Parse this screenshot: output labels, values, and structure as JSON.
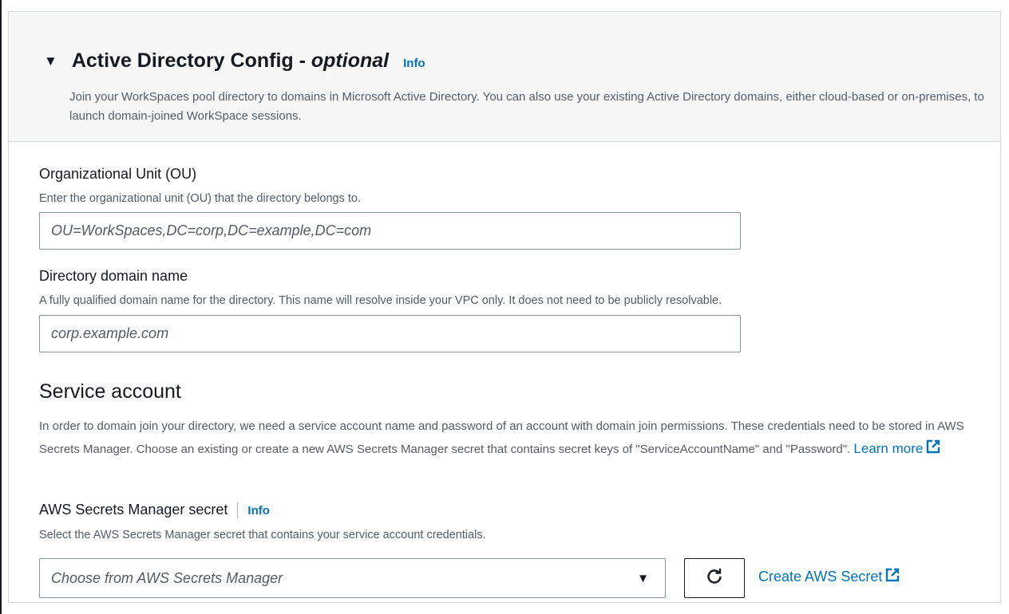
{
  "header": {
    "title": "Active Directory Config - ",
    "title_optional": "optional",
    "info_label": "Info",
    "description": "Join your WorkSpaces pool directory to domains in Microsoft Active Directory. You can also use your existing Active Directory domains, either cloud-based or on-premises, to launch domain-joined WorkSpace sessions."
  },
  "ou": {
    "label": "Organizational Unit (OU)",
    "description": "Enter the organizational unit (OU) that the directory belongs to.",
    "placeholder": "OU=WorkSpaces,DC=corp,DC=example,DC=com"
  },
  "domain": {
    "label": "Directory domain name",
    "description": "A fully qualified domain name for the directory. This name will resolve inside your VPC only. It does not need to be publicly resolvable.",
    "placeholder": "corp.example.com"
  },
  "service_account": {
    "title": "Service account",
    "description": "In order to domain join your directory, we need a service account name and password of an account with domain join permissions. These credentials need to be stored in AWS Secrets Manager. Choose an existing or create a new AWS Secrets Manager secret that contains secret keys of \"ServiceAccountName\" and \"Password\".",
    "learn_more": "Learn more"
  },
  "secret": {
    "label": "AWS Secrets Manager secret",
    "info_label": "Info",
    "description": "Select the AWS Secrets Manager secret that contains your service account credentials.",
    "select_placeholder": "Choose from AWS Secrets Manager",
    "create_link": "Create AWS Secret"
  },
  "colors": {
    "link": "#0073bb",
    "text": "#16191f",
    "secondary_text": "#545b64",
    "header_bg": "#f7f7f7",
    "border": "#879596"
  },
  "icons": [
    "caret-down-icon",
    "external-link-icon",
    "refresh-icon",
    "dropdown-arrow-icon"
  ]
}
